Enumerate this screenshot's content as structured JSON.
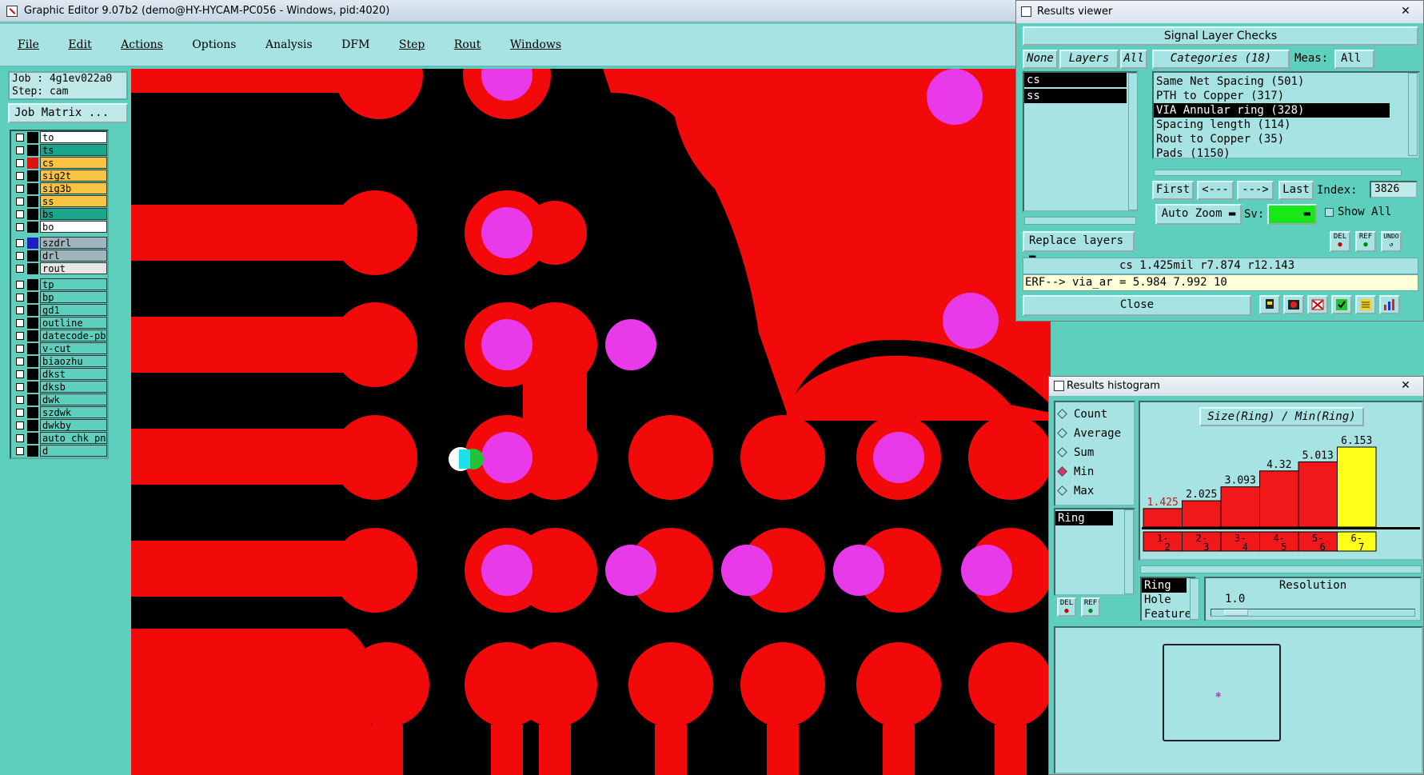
{
  "window": {
    "title": "Graphic Editor 9.07b2 (demo@HY-HYCAM-PC056 - Windows, pid:4020)"
  },
  "menu": [
    "File",
    "Edit",
    "Actions",
    "Options",
    "Analysis",
    "DFM",
    "Step",
    "Rout",
    "Windows"
  ],
  "job": {
    "job_line": "Job : 4g1ev022a0",
    "step_line": "Step: cam",
    "matrix_button": "Job Matrix ..."
  },
  "layers": {
    "group1": [
      {
        "name": "to",
        "color": "#ffffff",
        "sw": "#000000"
      },
      {
        "name": "ts",
        "color": "#1aa58c",
        "sw": "#000000"
      },
      {
        "name": "cs",
        "color": "#f6c343",
        "sw": "#e01010"
      },
      {
        "name": "sig2t",
        "color": "#f6c343",
        "sw": "#000000"
      },
      {
        "name": "sig3b",
        "color": "#f6c343",
        "sw": "#000000"
      },
      {
        "name": "ss",
        "color": "#f6c343",
        "sw": "#000000"
      },
      {
        "name": "bs",
        "color": "#1aa58c",
        "sw": "#000000"
      },
      {
        "name": "bo",
        "color": "#ffffff",
        "sw": "#000000"
      }
    ],
    "group2": [
      {
        "name": "szdrl",
        "color": "#9fb4bd",
        "sw": "#2020c0"
      },
      {
        "name": "drl",
        "color": "#9fb4bd",
        "sw": "#000000"
      },
      {
        "name": "rout",
        "color": "#e6e6e6",
        "sw": "#000000"
      }
    ],
    "group3": [
      {
        "name": "tp"
      },
      {
        "name": "bp"
      },
      {
        "name": "gd1"
      },
      {
        "name": "outline"
      },
      {
        "name": "datecode-pb"
      },
      {
        "name": "v-cut"
      },
      {
        "name": "biaozhu"
      },
      {
        "name": "dkst"
      },
      {
        "name": "dksb"
      },
      {
        "name": "dwk"
      },
      {
        "name": "szdwk"
      },
      {
        "name": "dwkby"
      },
      {
        "name": "auto_chk_pn"
      },
      {
        "name": "d"
      }
    ]
  },
  "results_viewer": {
    "title": "Results viewer",
    "header": "Signal Layer Checks",
    "tab_none": "None",
    "tab_layers": "Layers",
    "tab_all": "All",
    "categories_label": "Categories (18)",
    "meas_label": "Meas:",
    "meas_value": "All",
    "layer_items": [
      "cs",
      "ss"
    ],
    "categories": [
      "Same Net Spacing (501)",
      "PTH to Copper (317)",
      "VIA Annular ring (328)",
      "Spacing length (114)",
      "Rout to Copper (35)",
      "Pads (1150)"
    ],
    "nav": {
      "first": "First",
      "prev": "<---",
      "next": "--->",
      "last": "Last",
      "index_label": "Index:",
      "index_value": "3826"
    },
    "auto_zoom": "Auto Zoom",
    "sv_label": "Sv:",
    "show_all": "Show All",
    "replace_layers": "Replace layers",
    "status_line": "cs 1.425mil   r7.874  r12.143",
    "erf_line": "ERF--> via_ar = 5.984 7.992 10",
    "close": "Close",
    "del": "DEL",
    "ref": "REF",
    "undo": "UNDO"
  },
  "histogram": {
    "title": "Results histogram",
    "modes": [
      "Count",
      "Average",
      "Sum",
      "Min",
      "Max"
    ],
    "selected_mode": "Min",
    "chart_title": "Size(Ring) / Min(Ring)",
    "list_item": "Ring",
    "fields": [
      "Ring",
      "Hole",
      "Feature"
    ],
    "resolution_label": "Resolution",
    "resolution_value": "1.0",
    "del": "DEL",
    "ref": "REF"
  },
  "chart_data": {
    "type": "bar",
    "categories": [
      "1-2",
      "2-3",
      "3-4",
      "4-5",
      "5-6",
      "6-7"
    ],
    "values": [
      1.425,
      2.025,
      3.093,
      4.32,
      5.013,
      6.153
    ],
    "value_labels": [
      "1.425",
      "2.025",
      "3.093",
      "4.32",
      "5.013",
      "6.153"
    ],
    "highlighted_index": 5,
    "colors": {
      "bar": "#f01818",
      "highlight": "#ffff1a"
    }
  },
  "colors": {
    "copper": "#f20a0a",
    "drill": "#e83ae8",
    "background": "#000000",
    "panel": "#5fcfbd"
  }
}
